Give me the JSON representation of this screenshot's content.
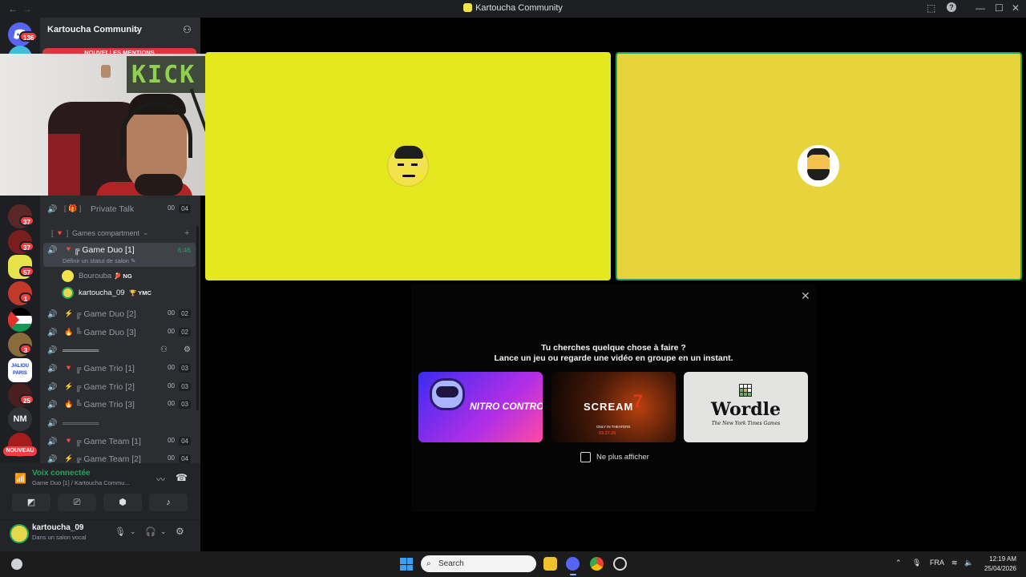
{
  "window": {
    "title": "Kartoucha Community",
    "back_arrow": "←",
    "forward_arrow": "→",
    "controls": [
      "⬚",
      "?",
      "—",
      "☐",
      "✕"
    ]
  },
  "server_rail": {
    "items": [
      {
        "icon": "discord-home-icon",
        "badge": "136"
      },
      {
        "icon": "server-icon-blue"
      },
      {
        "icon": "server-icon",
        "badge": "37"
      },
      {
        "icon": "server-icon",
        "badge": "37"
      },
      {
        "icon": "server-icon",
        "badge": "57"
      },
      {
        "icon": "server-icon",
        "badge": "1"
      },
      {
        "icon": "palestine-flag-icon"
      },
      {
        "icon": "server-icon",
        "badge": "3"
      },
      {
        "icon": "server-icon-label",
        "label": "JALIOU PARIS"
      },
      {
        "icon": "server-icon",
        "badge": "25"
      },
      {
        "icon": "server-initials",
        "label": "NM"
      },
      {
        "icon": "server-icon-new",
        "badge": "NOUVEAU"
      }
    ]
  },
  "sidebar": {
    "server_name": "Kartoucha Community",
    "server_chevron": "⌄",
    "mentions_banner": "NOUVELLES MENTIONS",
    "channels": [
      {
        "name": "Private Talk",
        "prefix": "[ 🎁 ]",
        "count_a": "00",
        "count_b": "04"
      },
      {
        "name": "Games compartment",
        "prefix": "[ 🔻 ]",
        "type": "category"
      },
      {
        "name": "╔ Game Duo [1]",
        "emoji": "🔻",
        "active": true,
        "timer": "6:46",
        "status_hint": "Définir un statut de salon ✎"
      },
      {
        "name": "╔ Game Duo [2]",
        "emoji": "⚡",
        "count_a": "00",
        "count_b": "02"
      },
      {
        "name": "╚ Game Duo [3]",
        "emoji": "🔥",
        "count_a": "00",
        "count_b": "02"
      },
      {
        "name": "════════",
        "type": "divider"
      },
      {
        "name": "╔ Game Trio [1]",
        "emoji": "🔻",
        "count_a": "00",
        "count_b": "03"
      },
      {
        "name": "╔ Game Trio [2]",
        "emoji": "⚡",
        "count_a": "00",
        "count_b": "03"
      },
      {
        "name": "╚ Game Trio [3]",
        "emoji": "🔥",
        "count_a": "00",
        "count_b": "03"
      },
      {
        "name": "════════",
        "type": "divider"
      },
      {
        "name": "╔ Game Team [1]",
        "emoji": "🔻",
        "count_a": "00",
        "count_b": "04"
      },
      {
        "name": "╔ Game Team [2]",
        "emoji": "⚡",
        "count_a": "00",
        "count_b": "04"
      }
    ],
    "voice_members": [
      {
        "name": "Bourouba",
        "tag": "🏓 NG",
        "muted_style": true
      },
      {
        "name": "kartoucha_09",
        "tag": "🏆 YMC",
        "muted_style": false
      }
    ]
  },
  "webcam": {
    "sign_text": "KICK"
  },
  "voice_panel": {
    "status": "Voix connectée",
    "location": "Game Duo [1] / Kartoucha Commu...",
    "buttons": [
      "camera-off-icon",
      "screen-share-icon",
      "activities-icon",
      "soundboard-icon"
    ]
  },
  "user": {
    "name": "kartoucha_09",
    "status": "Dans un salon vocal"
  },
  "activity": {
    "line1": "Tu cherches quelque chose à faire ?",
    "line2": "Lance un jeu ou regarde une vidéo en groupe en un instant.",
    "close": "✕",
    "cards": [
      {
        "title": "NITRO CONTROL",
        "color": "#7b2cf0"
      },
      {
        "title": "SCREAM",
        "subtitle": "ONLY IN THEATERS",
        "date": "03.27.26",
        "color": "#3a1408"
      },
      {
        "title": "Wordle",
        "subtitle": "The New York Times Games",
        "color": "#e3e3e1"
      }
    ],
    "checkbox_label": "Ne plus afficher"
  },
  "video_tiles": [
    {
      "color": "#e3e81f",
      "speaking": false
    },
    {
      "color": "#e7d43d",
      "speaking": true
    }
  ],
  "taskbar": {
    "search_placeholder": "Search",
    "tray": {
      "language": "FRA",
      "time": "12:19 AM",
      "date": "25/04/2026"
    }
  }
}
